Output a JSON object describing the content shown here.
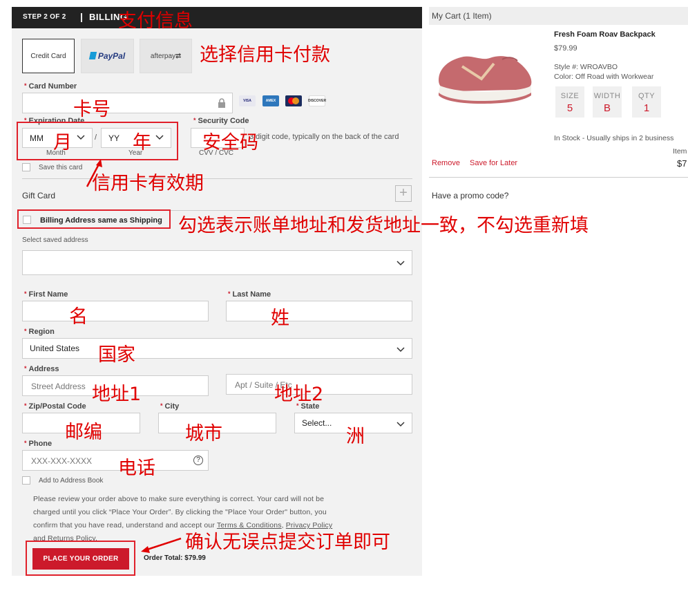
{
  "header": {
    "step": "STEP 2 OF 2",
    "separator": "|",
    "title": "BILLING"
  },
  "payment_methods": {
    "credit_card": "Credit Card",
    "paypal": "PayPal",
    "afterpay": "afterpay"
  },
  "card": {
    "number_label": "Card Number",
    "card_brands": [
      "VISA",
      "AMEX",
      "mastercard",
      "DISCOVER"
    ],
    "expiration_label": "Expiration Date",
    "month_value": "MM",
    "month_caption": "Month",
    "year_slash": "/",
    "year_value": "YY",
    "year_caption": "Year",
    "security_label": "Security Code",
    "security_hint": "3 digit code, typically on the back of the card",
    "security_caption": "CVV / CVC",
    "save_card": "Save this card"
  },
  "gift_card": {
    "label": "Gift Card",
    "add_symbol": "+"
  },
  "billing_same": "Billing Address same as Shipping",
  "saved_address_label": "Select saved address",
  "form": {
    "first_name_label": "First Name",
    "last_name_label": "Last Name",
    "region_label": "Region",
    "region_value": "United States",
    "address_label": "Address",
    "street_placeholder": "Street Address",
    "apt_placeholder": "Apt / Suite / Etc",
    "zip_label": "Zip/Postal Code",
    "city_label": "City",
    "state_label": "State",
    "state_value": "Select...",
    "phone_label": "Phone",
    "phone_placeholder": "XXX-XXX-XXXX",
    "phone_help": "?",
    "add_address_book": "Add to Address Book"
  },
  "legal": {
    "text_1": "Please review your order above to make sure everything is correct. Your card will not be",
    "text_2": "charged until you click “Place Your Order”. By clicking the \"Place Your Order\" button, you",
    "text_3a": "confirm that you have read, understand and accept our ",
    "terms": "Terms & Conditions",
    "comma": ", ",
    "privacy": "Privacy Policy",
    "text_4": "and Returns Policy."
  },
  "place_order": "PLACE YOUR ORDER",
  "order_total": "Order Total: $79.99",
  "cart": {
    "title": "My Cart (1 Item)",
    "product_name": "Fresh Foam Roav Backpack",
    "price": "$79.99",
    "style": "Style #: WROAVBO",
    "color": "Color: Off Road with Workwear",
    "size_label": "SIZE",
    "size_value": "5",
    "width_label": "WIDTH",
    "width_value": "B",
    "qty_label": "QTY",
    "qty_value": "1",
    "stock": "In Stock - Usually ships in 2 business",
    "item_label": "Item",
    "item_total": "$7",
    "remove": "Remove",
    "save_later": "Save for Later",
    "promo": "Have a promo code?"
  },
  "annotations": {
    "payment_info": "支付信息",
    "choose_credit_card": "选择信用卡付款",
    "card_number": "卡号",
    "month": "月",
    "year": "年",
    "security_code": "安全码",
    "expiry": "信用卡有效期",
    "billing_note": "勾选表示账单地址和发货地址一致，不勾选重新填",
    "first_name": "名",
    "last_name": "姓",
    "country": "国家",
    "address1": "地址1",
    "address2": "地址2",
    "zip": "邮编",
    "city": "城市",
    "state": "洲",
    "phone": "电话",
    "confirm": "确认无误点提交订单即可"
  },
  "colors": {
    "accent_red": "#cc1a2b",
    "annotation_red": "#e00000",
    "header_bg": "#222222"
  }
}
